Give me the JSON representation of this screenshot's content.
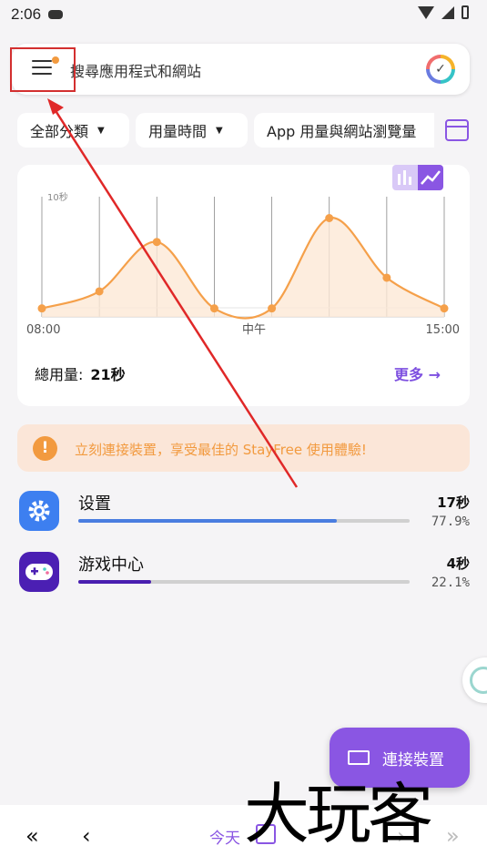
{
  "status": {
    "time": "2:06"
  },
  "search": {
    "placeholder": "搜尋應用程式和網站"
  },
  "filters": {
    "category": "全部分類",
    "metric": "用量時間",
    "scope": "App 用量與網站瀏覽量"
  },
  "chart_data": {
    "type": "line",
    "ylabel": "10秒",
    "x_tick_labels": [
      "08:00",
      "中午",
      "15:00"
    ],
    "x": [
      "08:00",
      "09:00",
      "10:00",
      "11:00",
      "12:00",
      "13:00",
      "14:00",
      "15:00"
    ],
    "series": [
      {
        "values": [
          1.0,
          3.0,
          8.8,
          1.0,
          1.0,
          11.6,
          4.6,
          1.0
        ]
      }
    ],
    "ylim": [
      0,
      12
    ],
    "grid": true,
    "color": "#f5a04a",
    "fill": "#fde9d6"
  },
  "summary": {
    "total_label": "總用量:",
    "total_value": "21秒",
    "more_label": "更多 →"
  },
  "banner": {
    "text": "立刻連接裝置，享受最佳的 StayFree 使用體驗!",
    "icon": "!"
  },
  "apps": [
    {
      "name": "设置",
      "time": "17秒",
      "percent": "77.9%",
      "fraction": 0.779,
      "color": "#4a7de0",
      "icon": "gear-icon"
    },
    {
      "name": "游戏中心",
      "time": "4秒",
      "percent": "22.1%",
      "fraction": 0.221,
      "color": "#4a1fb0",
      "icon": "gamepad-icon"
    }
  ],
  "fab": {
    "label": "連接裝置"
  },
  "nav": {
    "first": "«",
    "prev": "‹",
    "today": "今天",
    "next": "›",
    "last": "»"
  },
  "watermark": "大玩客"
}
